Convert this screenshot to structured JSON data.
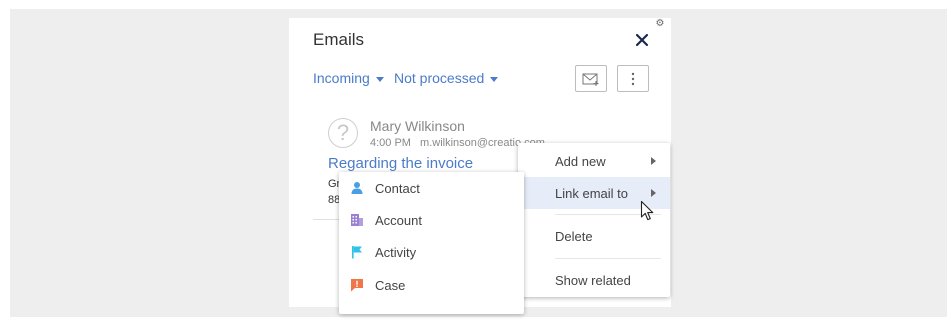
{
  "panel": {
    "title": "Emails",
    "filters": [
      {
        "label": "Incoming"
      },
      {
        "label": "Not processed"
      }
    ]
  },
  "email": {
    "sender_name": "Mary Wilkinson",
    "time": "4:00 PM",
    "sender_email": "m.wilkinson@creatio.com",
    "subject": "Regarding the invoice",
    "body_lines": [
      "Gr",
      "88"
    ]
  },
  "context_menu": {
    "items": [
      {
        "label": "Add new"
      },
      {
        "label": "Link email to"
      },
      {
        "label": "Delete"
      },
      {
        "label": "Show related"
      }
    ]
  },
  "link_submenu": {
    "items": [
      {
        "label": "Contact",
        "icon": "contact-icon",
        "color": "#4a9ee6"
      },
      {
        "label": "Account",
        "icon": "account-icon",
        "color": "#9b7fd1"
      },
      {
        "label": "Activity",
        "icon": "activity-flag-icon",
        "color": "#2fc3e8"
      },
      {
        "label": "Case",
        "icon": "case-icon",
        "color": "#f0764a"
      }
    ]
  },
  "colors": {
    "accent": "#4a7cc9",
    "highlight": "#e6ecf8"
  }
}
